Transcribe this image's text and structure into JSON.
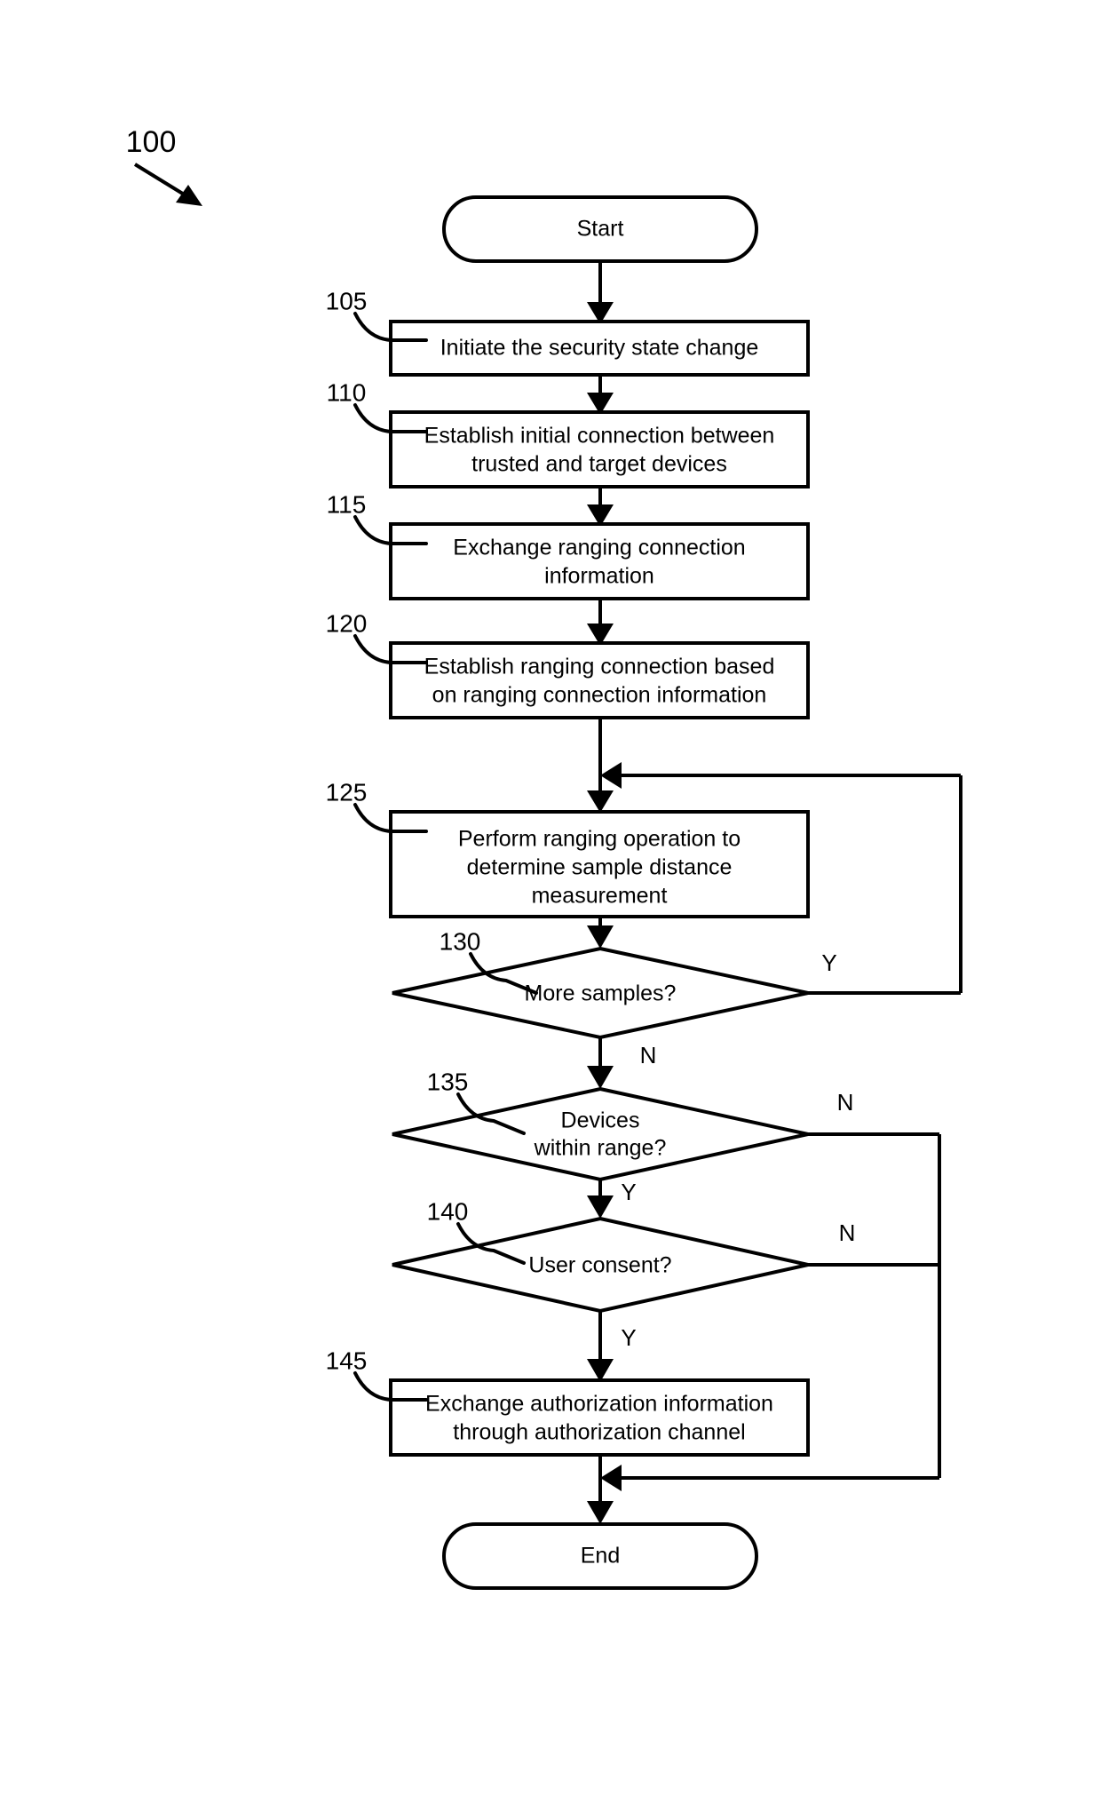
{
  "figure": {
    "number_label": "100",
    "pointer_icon": "arrow-down-right-icon"
  },
  "nodes": {
    "start": {
      "label": "Start",
      "shape": "stadium"
    },
    "n105": {
      "ref": "105",
      "lines": [
        "Initiate the security state change"
      ],
      "shape": "process"
    },
    "n110": {
      "ref": "110",
      "lines": [
        "Establish initial connection between",
        "trusted and target devices"
      ],
      "shape": "process"
    },
    "n115": {
      "ref": "115",
      "lines": [
        "Exchange ranging connection",
        "information"
      ],
      "shape": "process"
    },
    "n120": {
      "ref": "120",
      "lines": [
        "Establish ranging connection based",
        "on ranging connection information"
      ],
      "shape": "process"
    },
    "n125": {
      "ref": "125",
      "lines": [
        "Perform ranging operation to",
        "determine sample distance",
        "measurement"
      ],
      "shape": "process"
    },
    "n130": {
      "ref": "130",
      "lines": [
        "More samples?"
      ],
      "shape": "decision"
    },
    "n135": {
      "ref": "135",
      "lines": [
        "Devices",
        "within range?"
      ],
      "shape": "decision"
    },
    "n140": {
      "ref": "140",
      "lines": [
        "User consent?"
      ],
      "shape": "decision"
    },
    "n145": {
      "ref": "145",
      "lines": [
        "Exchange authorization information",
        "through authorization channel"
      ],
      "shape": "process"
    },
    "end": {
      "label": "End",
      "shape": "stadium"
    }
  },
  "branch_labels": {
    "samples_yes": "Y",
    "samples_no": "N",
    "range_no": "N",
    "range_yes": "Y",
    "consent_no": "N",
    "consent_yes": "Y"
  },
  "colors": {
    "stroke": "#000000",
    "fill": "#ffffff",
    "background": "#ffffff"
  }
}
